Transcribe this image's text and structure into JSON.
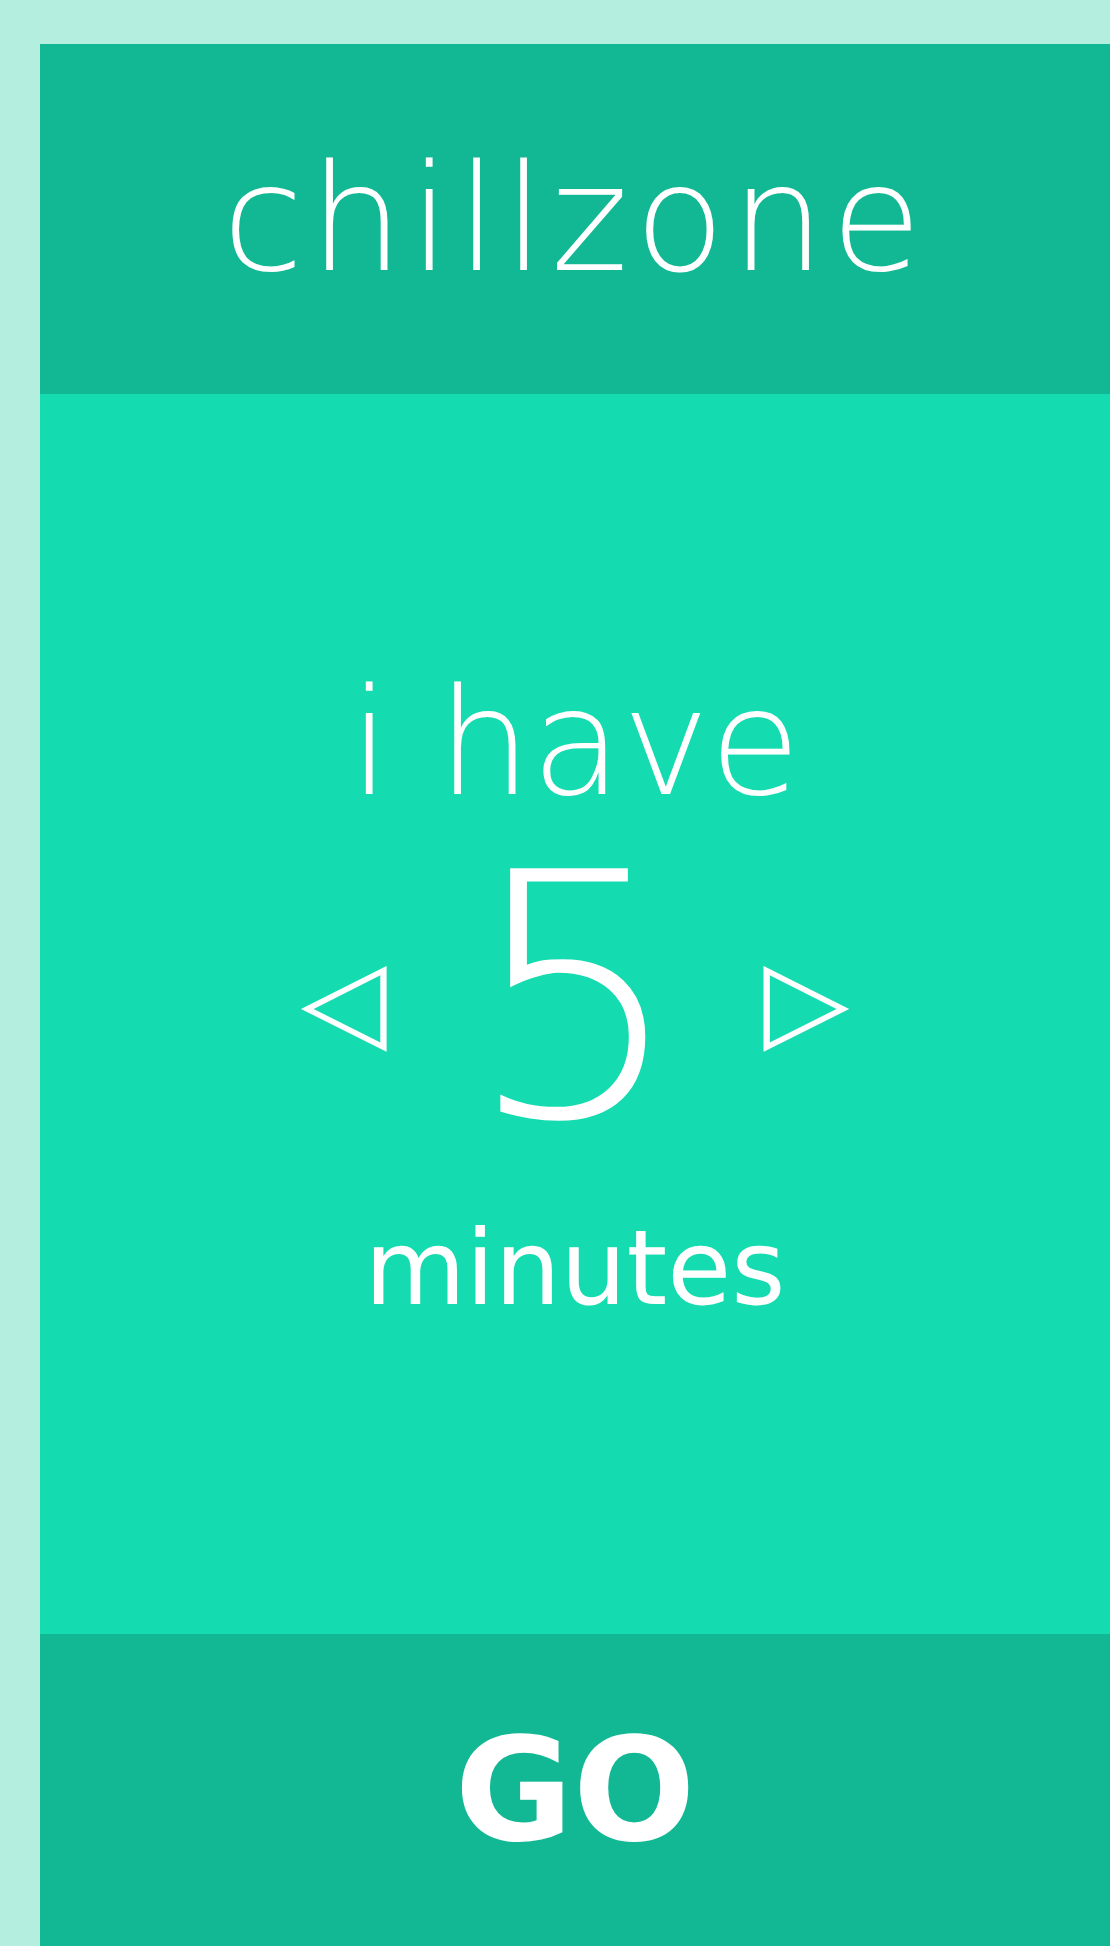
{
  "header": {
    "title": "chillzone"
  },
  "timer": {
    "prefix": "i have",
    "decrease": "◁",
    "value": "5",
    "increase": "▷",
    "unit": "minutes"
  },
  "footer": {
    "button": "GO"
  }
}
